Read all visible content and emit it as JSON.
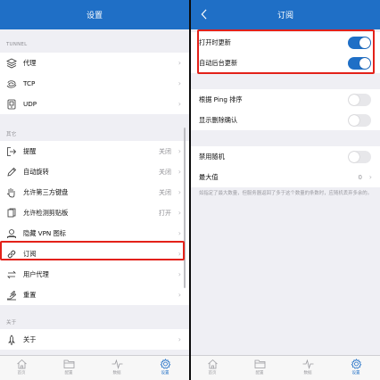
{
  "left": {
    "title": "设置",
    "sections": {
      "tunnel": "TUNNEL",
      "other": "其它",
      "about": "关于"
    },
    "tunnel_items": [
      {
        "label": "代理",
        "icon": "stack-layers-icon"
      },
      {
        "label": "TCP",
        "icon": "swirl-icon"
      },
      {
        "label": "UDP",
        "icon": "device-icon"
      }
    ],
    "other_items": [
      {
        "label": "提醒",
        "value": "关闭",
        "icon": "exit-arrow-icon"
      },
      {
        "label": "自动旋转",
        "value": "关闭",
        "icon": "pencil-icon"
      },
      {
        "label": "允许第三方键盘",
        "value": "关闭",
        "icon": "hand-icon"
      },
      {
        "label": "允许检测剪贴板",
        "value": "打开",
        "icon": "clipboard-icon"
      },
      {
        "label": "隐藏 VPN 图标",
        "value": "",
        "icon": "person-icon"
      },
      {
        "label": "订阅",
        "value": "",
        "icon": "link-icon"
      },
      {
        "label": "用户代理",
        "value": "",
        "icon": "arrows-icon"
      },
      {
        "label": "重置",
        "value": "",
        "icon": "hand-wave-icon"
      }
    ],
    "about_items": [
      {
        "label": "关于",
        "icon": "rocket-icon"
      }
    ]
  },
  "right": {
    "title": "订阅",
    "toggles": [
      {
        "label": "打开时更新",
        "on": true
      },
      {
        "label": "自动后台更新",
        "on": true
      },
      {
        "label": "根据 Ping 排序",
        "on": false
      },
      {
        "label": "显示删除确认",
        "on": false
      },
      {
        "label": "禁用随机",
        "on": false
      }
    ],
    "max": {
      "label": "最大值",
      "value": "0"
    },
    "note": "如指定了最大数量，但服务器返回了多于这个数量的条数时，应随机丢弃多余的。"
  },
  "tabbar": [
    {
      "label": "首页",
      "icon": "home-icon"
    },
    {
      "label": "配置",
      "icon": "folder-icon"
    },
    {
      "label": "数据",
      "icon": "pulse-icon"
    },
    {
      "label": "设置",
      "icon": "gear-icon"
    }
  ],
  "colors": {
    "accent": "#1f6fc6",
    "highlight": "#e32119",
    "background": "#efeff4"
  }
}
